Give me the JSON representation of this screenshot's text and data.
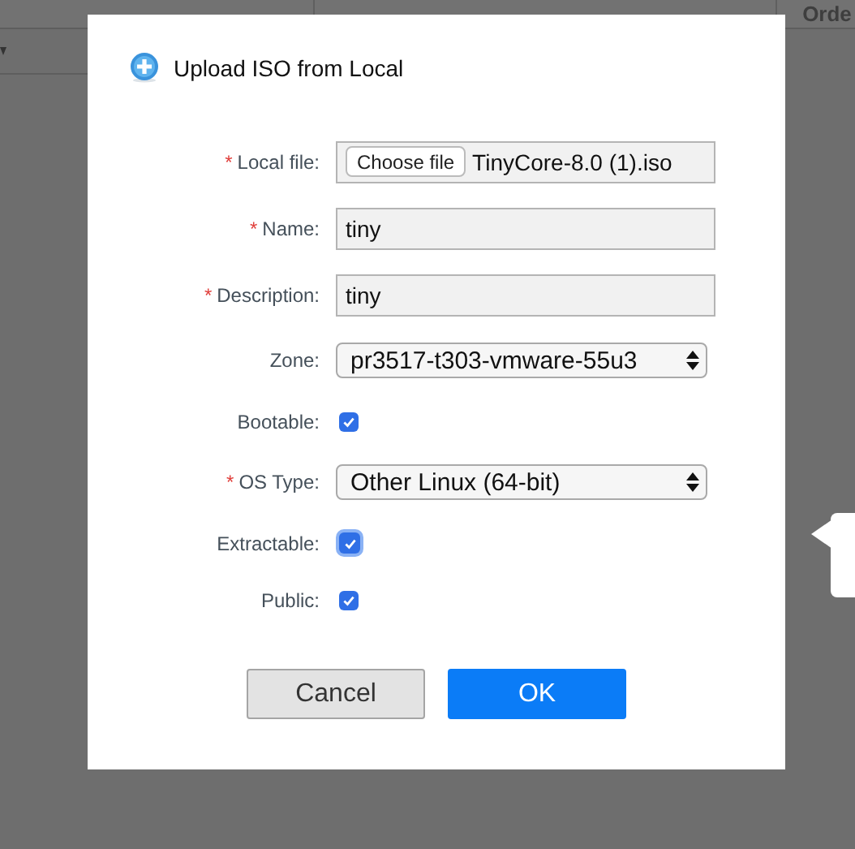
{
  "background": {
    "columns": [
      "Orde"
    ]
  },
  "dialog": {
    "title": "Upload ISO from Local",
    "fields": [
      {
        "kind": "file",
        "label": "Local file:",
        "required_mark": "*",
        "button_label": "Choose file",
        "value": "TinyCore-8.0 (1).iso"
      },
      {
        "kind": "text",
        "label": "Name:",
        "required_mark": "*",
        "value": "tiny"
      },
      {
        "kind": "text",
        "label": "Description:",
        "required_mark": "*",
        "value": "tiny"
      },
      {
        "kind": "select",
        "label": "Zone:",
        "value": "pr3517-t303-vmware-55u3"
      },
      {
        "kind": "checkbox",
        "label": "Bootable:",
        "checked": true,
        "focused": false
      },
      {
        "kind": "select",
        "label": "OS Type:",
        "required_mark": "*",
        "value": "Other Linux (64-bit)"
      },
      {
        "kind": "checkbox",
        "label": "Extractable:",
        "checked": true,
        "focused": true
      },
      {
        "kind": "checkbox",
        "label": "Public:",
        "checked": true,
        "focused": false
      }
    ],
    "buttons": [
      {
        "label": "Cancel",
        "kind": "secondary"
      },
      {
        "label": "OK",
        "kind": "primary"
      }
    ]
  }
}
